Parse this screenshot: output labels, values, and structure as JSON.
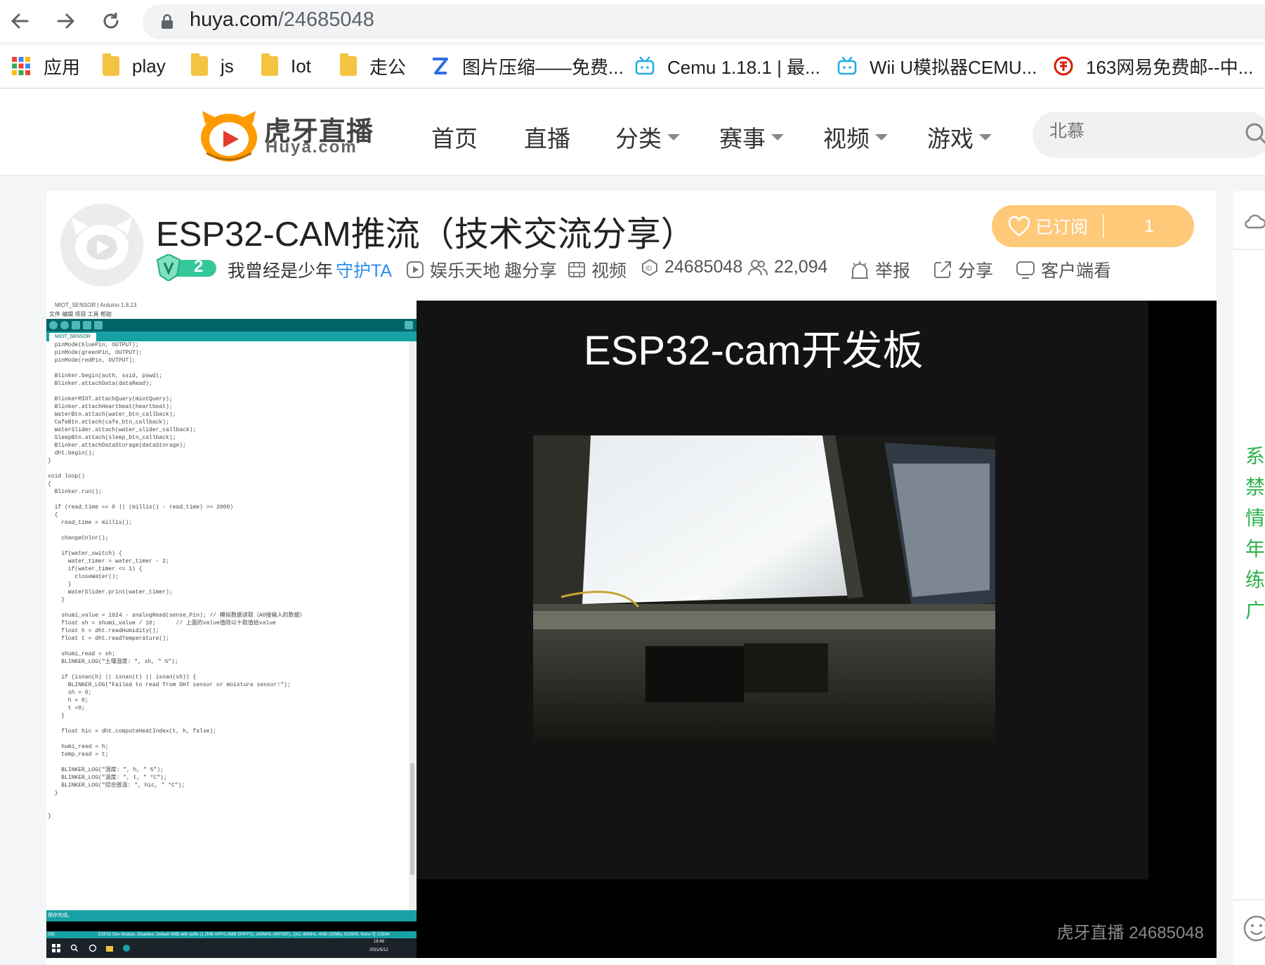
{
  "browser": {
    "url_host": "huya.com",
    "url_path": "/24685048"
  },
  "bookmarks": [
    {
      "label": "应用",
      "icon": "apps-grid-icon"
    },
    {
      "label": "play",
      "icon": "folder-icon"
    },
    {
      "label": "js",
      "icon": "folder-icon"
    },
    {
      "label": "Iot",
      "icon": "folder-icon"
    },
    {
      "label": "走公",
      "icon": "folder-icon"
    },
    {
      "label": "图片压缩——免费...",
      "icon": "zip-icon"
    },
    {
      "label": "Cemu 1.18.1 | 最...",
      "icon": "bilibili-icon"
    },
    {
      "label": "Wii U模拟器CEMU...",
      "icon": "bilibili-icon"
    },
    {
      "label": "163网易免费邮--中...",
      "icon": "netease-icon"
    }
  ],
  "site": {
    "logo_cn": "虎牙直播",
    "logo_en": "Huya.com",
    "nav": [
      {
        "label": "首页",
        "dropdown": false
      },
      {
        "label": "直播",
        "dropdown": false
      },
      {
        "label": "分类",
        "dropdown": true
      },
      {
        "label": "赛事",
        "dropdown": true
      },
      {
        "label": "视频",
        "dropdown": true
      },
      {
        "label": "游戏",
        "dropdown": true
      }
    ],
    "search_placeholder": "北慕"
  },
  "room": {
    "title": "ESP32-CAM推流（技术交流分享）",
    "badge_level": "2",
    "streamer": "我曾经是少年",
    "guard": "守护TA",
    "category": "娱乐天地",
    "subcategory": "趣分享",
    "video_label": "视频",
    "room_id": "24685048",
    "viewers": "22,094",
    "report": "举报",
    "share": "分享",
    "client": "客户端看",
    "subscribe_label": "已订阅",
    "subscribe_count": "1"
  },
  "player": {
    "slide_title": "ESP32-cam开发板",
    "watermark": "虎牙直播 24685048",
    "ide_title": "MIOT_SENSOR | Arduino 1.8.13",
    "ide_menu": "文件 编辑 项目 工具 帮助",
    "ide_tab": "MIOT_SENSOR",
    "ide_status": "保存完成。",
    "ide_bottom": "ESP32 Dev Module, Disabled, Default 4MB with spiffs (1.2MB APP/1.5MB SPIFFS), 240MHz (WiFi/BT), QIO, 80MHz, 4MB (32Mb), 921600, None 在 COM4",
    "ide_line_no": "282",
    "clock_time": "18:48",
    "clock_date": "2021/5/12",
    "code": [
      "  pinMode(bluePin, OUTPUT);",
      "  pinMode(greenPin, OUTPUT);",
      "  pinMode(redPin, OUTPUT);",
      "",
      "  Blinker.begin(auth, ssid, pswd);",
      "  Blinker.attachData(dataRead);",
      "",
      "  BlinkerMIOT.attachQuery(miotQuery);",
      "  Blinker.attachHeartbeat(heartbeat);",
      "  WaterBtn.attach(water_btn_callback);",
      "  CafeBtn.attach(cafe_btn_callback);",
      "  WaterSlider.attach(water_slider_callback);",
      "  SleepBtn.attach(sleep_btn_callback);",
      "  Blinker.attachDataStorage(dataStorage);",
      "  dht.begin();",
      "}",
      "",
      "void loop()",
      "{",
      "  Blinker.run();",
      "",
      "  if (read_time == 0 || (millis() - read_time) >= 2000)",
      "  {",
      "    read_time = millis();",
      "",
      "    changeColor();",
      "",
      "    if(water_switch) {",
      "      water_timer = water_timer - 2;",
      "      if(water_timer <= 1) {",
      "        closeWater();",
      "      }",
      "      WaterSlider.print(water_timer);",
      "    }",
      "",
      "    shumi_value = 1024 - analogRead(sense_Pin); // 模拟数据读取（A0接输入的数据）",
      "    float sh = shumi_value / 10;      // 上面的value值除以十取值给value",
      "    float h = dht.readHumidity();",
      "    float t = dht.readTemperature();",
      "",
      "    shumi_read = sh;",
      "    BLINKER_LOG(\"土壤湿度: \", sh, \" %\");",
      "",
      "    if (isnan(h) || isnan(t) || isnan(sh)) {",
      "      BLINKER_LOG(\"Failed to read from DHT sensor or moisture sensor!\");",
      "      sh = 0;",
      "      h = 0;",
      "      t =0;",
      "    }",
      "",
      "    float hic = dht.computeHeatIndex(t, h, false);",
      "",
      "    humi_read = h;",
      "    temp_read = t;",
      "",
      "    BLINKER_LOG(\"湿度: \", h, \" %\");",
      "    BLINKER_LOG(\"温度: \", t, \" *C\");",
      "    BLINKER_LOG(\"综合感温: \", hic, \" *C\");",
      "  }",
      "",
      "",
      "}"
    ]
  },
  "side_panel": {
    "chars": [
      "系",
      "禁",
      "情",
      "年",
      "练",
      "广"
    ]
  },
  "colors": {
    "huya_orange": "#ff9b00",
    "subscribe_bg": "#ffc97a",
    "link_blue": "#2e8ef2",
    "arduino_teal": "#17a1a5",
    "side_green": "#2bb24c"
  }
}
